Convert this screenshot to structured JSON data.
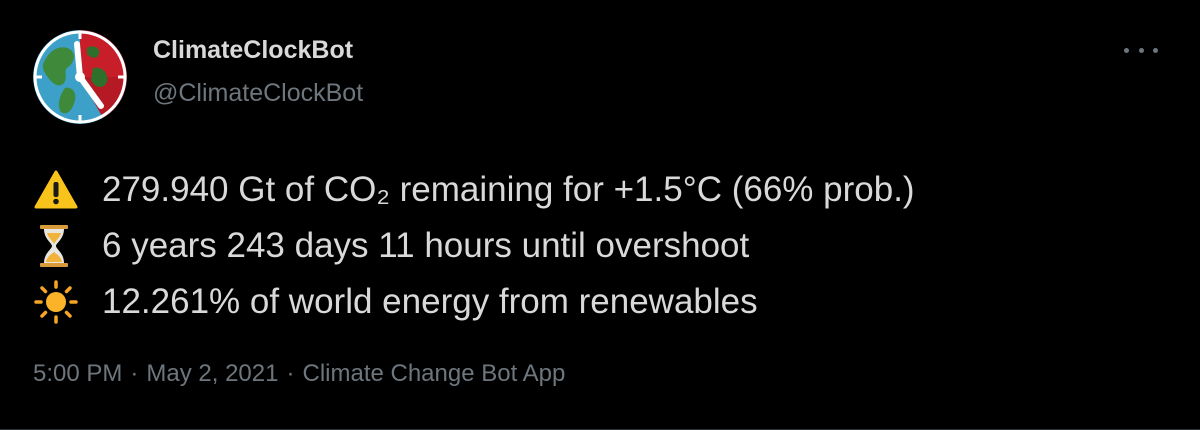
{
  "author": {
    "display_name": "ClimateClockBot",
    "handle": "@ClimateClockBot",
    "avatar_icon": "climate-clock-globe-icon"
  },
  "more_menu_icon": "more-horizontal-icon",
  "lines": [
    {
      "icon": "warning-icon",
      "text": "279.940 Gt of CO₂ remaining for +1.5°C (66% prob.)"
    },
    {
      "icon": "hourglass-icon",
      "text": "6 years 243 days 11 hours until overshoot"
    },
    {
      "icon": "sun-icon",
      "text": "12.261% of world energy from renewables"
    }
  ],
  "meta": {
    "time": "5:00 PM",
    "separator": "·",
    "date": "May 2, 2021",
    "source": "Climate Change Bot App"
  },
  "colors": {
    "background": "#000000",
    "text": "#d9d9d9",
    "secondary": "#6e767d",
    "divider": "#2f3336"
  }
}
